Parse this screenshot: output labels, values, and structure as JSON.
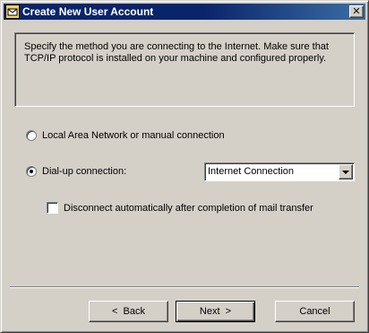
{
  "window": {
    "title": "Create New User Account",
    "close_symbol": "✕"
  },
  "info": {
    "text": "Specify the method you are connecting to the Internet. Make sure that TCP/IP protocol is installed on your machine and configured properly."
  },
  "options": {
    "lan_label": "Local Area Network or manual connection",
    "lan_selected": false,
    "dialup_label": "Dial-up connection:",
    "dialup_selected": true,
    "dialup_connection_value": "Internet Connection",
    "disconnect_label": "Disconnect automatically after completion of mail transfer",
    "disconnect_checked": false
  },
  "buttons": {
    "back_label": "<  Back",
    "next_label": "Next  >",
    "cancel_label": "Cancel"
  },
  "colors": {
    "titlebar_start": "#0a246a",
    "titlebar_end": "#3a6ea5",
    "dialog_face": "#d4d0c8"
  }
}
